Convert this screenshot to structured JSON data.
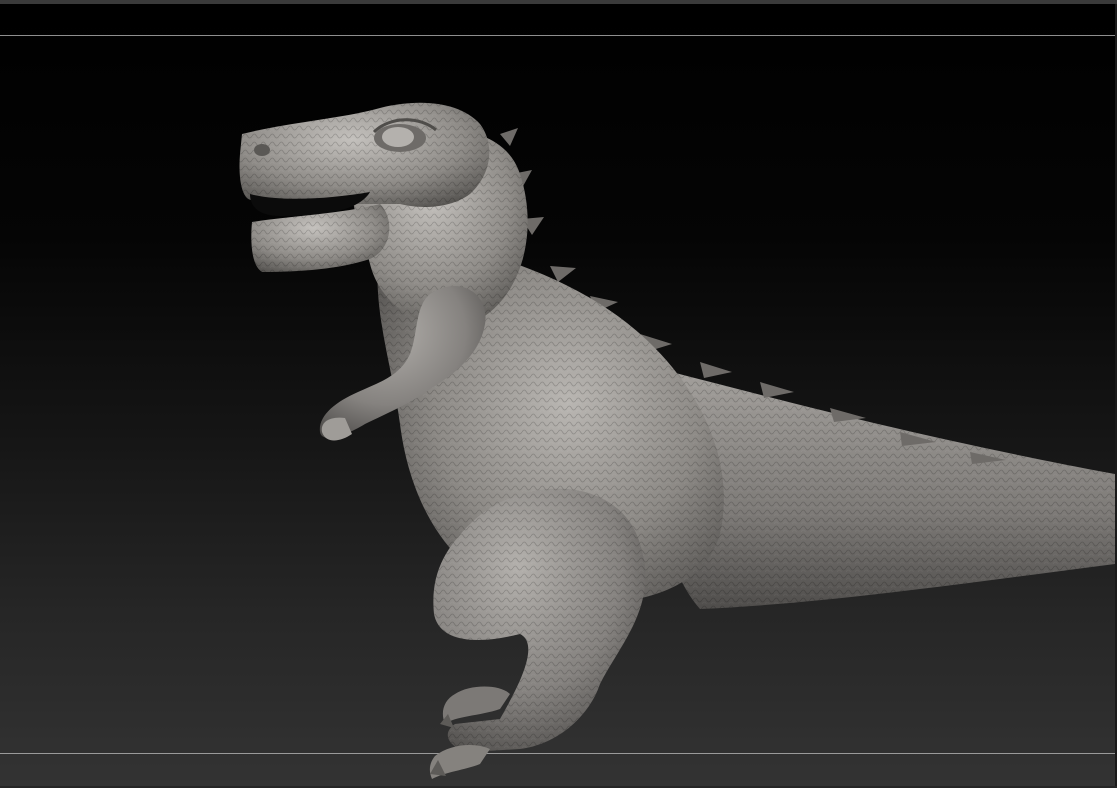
{
  "app": {
    "bg_color": "#262626",
    "model_color": "#8a8783"
  },
  "viewport": {
    "content": "sculpted-dinosaur-model",
    "guides": [
      "top-guide",
      "bottom-guide"
    ]
  }
}
